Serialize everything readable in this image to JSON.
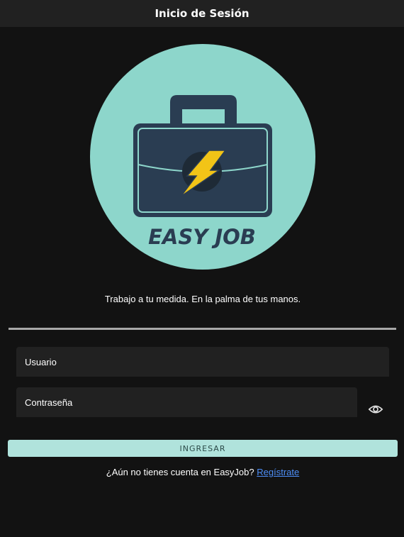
{
  "appbar": {
    "title": "Inicio de Sesión"
  },
  "logo": {
    "text": "EASY JOB",
    "circle_color": "#8dd6cb",
    "case_color": "#2a3d52",
    "bolt_color": "#f2c417"
  },
  "tagline": "Trabajo a tu medida. En la palma de tus manos.",
  "form": {
    "username_placeholder": "Usuario",
    "password_placeholder": "Contraseña",
    "submit_label": "INGRESAR"
  },
  "register": {
    "prompt": "¿Aún no tienes cuenta en EasyJob?",
    "link_label": "Regístrate"
  },
  "colors": {
    "background": "#121212",
    "appbar": "#212121",
    "field": "#212121",
    "button": "#b0e3dc",
    "link": "#4d8ef7"
  }
}
